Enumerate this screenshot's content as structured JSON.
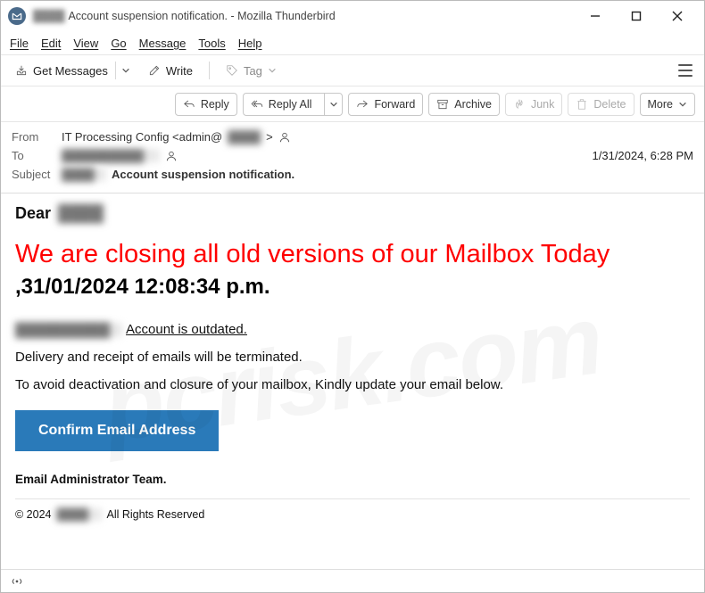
{
  "title": {
    "prefix_redacted": "████",
    "text": "Account suspension notification. - Mozilla Thunderbird"
  },
  "menu": {
    "file": "File",
    "edit": "Edit",
    "view": "View",
    "go": "Go",
    "message": "Message",
    "tools": "Tools",
    "help": "Help"
  },
  "toolbar": {
    "get_messages": "Get Messages",
    "write": "Write",
    "tag": "Tag"
  },
  "actions": {
    "reply": "Reply",
    "reply_all": "Reply All",
    "forward": "Forward",
    "archive": "Archive",
    "junk": "Junk",
    "delete": "Delete",
    "more": "More"
  },
  "header": {
    "from_label": "From",
    "from_value": "IT Processing Config <admin@",
    "from_redacted": "████",
    "from_close": ">",
    "to_label": "To",
    "to_redacted": "██████████",
    "subject_label": "Subject",
    "subject_redacted": "████",
    "subject_value": "Account suspension notification.",
    "date": "1/31/2024, 6:28 PM"
  },
  "body": {
    "dear": "Dear",
    "dear_redacted": "████",
    "headline": "We are closing all old versions of our Mailbox Today",
    "dateline": " ,31/01/2024 12:08:34 p.m.",
    "account_redacted": "██████████",
    "account_outdated": "Account is outdated.",
    "para1": "Delivery and receipt of emails will be terminated.",
    "para2": "To avoid deactivation and closure   of your mailbox, Kindly update your email below.",
    "cta": "Confirm Email Address",
    "signature": "Email Administrator Team.",
    "copyright_prefix": "© 2024",
    "copyright_redacted": "████",
    "copyright_suffix": "All Rights Reserved"
  },
  "watermark": "pcrisk.com"
}
